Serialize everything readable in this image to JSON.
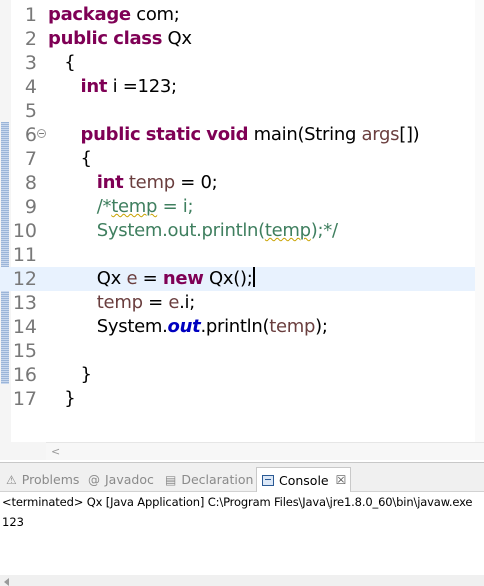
{
  "editor": {
    "lines": [
      {
        "n": "1",
        "tokens": [
          {
            "t": "package",
            "c": "kw"
          },
          {
            "t": " com;",
            "c": ""
          }
        ]
      },
      {
        "n": "2",
        "tokens": [
          {
            "t": "public",
            "c": "kw"
          },
          {
            "t": " ",
            "c": ""
          },
          {
            "t": "class",
            "c": "kw"
          },
          {
            "t": " Qx",
            "c": ""
          }
        ]
      },
      {
        "n": "3",
        "tokens": [
          {
            "t": "   {",
            "c": ""
          }
        ]
      },
      {
        "n": "4",
        "tokens": [
          {
            "t": "      ",
            "c": ""
          },
          {
            "t": "int",
            "c": "kw"
          },
          {
            "t": " i =123;",
            "c": ""
          }
        ]
      },
      {
        "n": "5",
        "tokens": []
      },
      {
        "n": "6",
        "fold": true,
        "tokens": [
          {
            "t": "      ",
            "c": ""
          },
          {
            "t": "public",
            "c": "kw"
          },
          {
            "t": " ",
            "c": ""
          },
          {
            "t": "static",
            "c": "kw"
          },
          {
            "t": " ",
            "c": ""
          },
          {
            "t": "void",
            "c": "kw"
          },
          {
            "t": " main(String ",
            "c": ""
          },
          {
            "t": "args",
            "c": "var"
          },
          {
            "t": "[])",
            "c": ""
          }
        ]
      },
      {
        "n": "7",
        "tokens": [
          {
            "t": "      {",
            "c": ""
          }
        ]
      },
      {
        "n": "8",
        "tokens": [
          {
            "t": "         ",
            "c": ""
          },
          {
            "t": "int",
            "c": "kw"
          },
          {
            "t": " ",
            "c": ""
          },
          {
            "t": "temp",
            "c": "var"
          },
          {
            "t": " = 0;",
            "c": ""
          }
        ]
      },
      {
        "n": "9",
        "tokens": [
          {
            "t": "         ",
            "c": ""
          },
          {
            "t": "/*",
            "c": "cm"
          },
          {
            "t": "temp",
            "c": "cm squig"
          },
          {
            "t": " = i;",
            "c": "cm"
          }
        ]
      },
      {
        "n": "10",
        "tokens": [
          {
            "t": "         ",
            "c": ""
          },
          {
            "t": "System.out.println(",
            "c": "cm"
          },
          {
            "t": "temp",
            "c": "cm squig"
          },
          {
            "t": ");*/",
            "c": "cm"
          }
        ]
      },
      {
        "n": "11",
        "tokens": []
      },
      {
        "n": "12",
        "current": true,
        "caret": true,
        "tokens": [
          {
            "t": "         Qx ",
            "c": ""
          },
          {
            "t": "e",
            "c": "var"
          },
          {
            "t": " = ",
            "c": ""
          },
          {
            "t": "new",
            "c": "kw"
          },
          {
            "t": " Qx();",
            "c": ""
          }
        ]
      },
      {
        "n": "13",
        "tokens": [
          {
            "t": "         ",
            "c": ""
          },
          {
            "t": "temp",
            "c": "var"
          },
          {
            "t": " = ",
            "c": ""
          },
          {
            "t": "e",
            "c": "var"
          },
          {
            "t": ".i;",
            "c": ""
          }
        ]
      },
      {
        "n": "14",
        "tokens": [
          {
            "t": "         System.",
            "c": ""
          },
          {
            "t": "out",
            "c": "fld"
          },
          {
            "t": ".println(",
            "c": ""
          },
          {
            "t": "temp",
            "c": "var"
          },
          {
            "t": ");",
            "c": ""
          }
        ]
      },
      {
        "n": "15",
        "tokens": []
      },
      {
        "n": "16",
        "tokens": [
          {
            "t": "      }",
            "c": ""
          }
        ]
      },
      {
        "n": "17",
        "tokens": [
          {
            "t": "   }",
            "c": ""
          }
        ]
      }
    ]
  },
  "console_panel": {
    "tabs": [
      {
        "label": "Problems",
        "icon": "problems-icon",
        "glyph": "⚠",
        "active": false
      },
      {
        "label": "Javadoc",
        "icon": "javadoc-icon",
        "glyph": "@",
        "active": false
      },
      {
        "label": "Declaration",
        "icon": "declaration-icon",
        "glyph": "▤",
        "active": false
      },
      {
        "label": "Console",
        "icon": "console-icon",
        "glyph": "",
        "active": true
      }
    ],
    "close_glyph": "☒",
    "status": "<terminated> Qx [Java Application] C:\\Program Files\\Java\\jre1.8.0_60\\bin\\javaw.exe",
    "output": "123"
  },
  "colors": {
    "keyword": "#7f0055",
    "comment": "#3f7f5f",
    "local_variable": "#6a3e3e",
    "static_field": "#0000c0",
    "current_line": "#e8f2fe"
  }
}
